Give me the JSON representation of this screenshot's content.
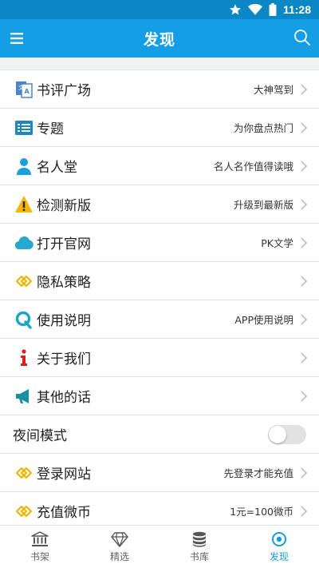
{
  "status_bar": {
    "time": "11:28"
  },
  "app_bar": {
    "title": "发现"
  },
  "rows": [
    {
      "label": "书评广场",
      "hint": "大神驾到",
      "icon": "translate-icon"
    },
    {
      "label": "专题",
      "hint": "为你盘点热门",
      "icon": "list-icon"
    },
    {
      "label": "名人堂",
      "hint": "名人名作值得读哦",
      "icon": "person-icon"
    },
    {
      "label": "检测新版",
      "hint": "升级到最新版",
      "icon": "warning-icon"
    },
    {
      "label": "打开官网",
      "hint": "PK文学",
      "icon": "cloud-icon"
    },
    {
      "label": "隐私策略",
      "hint": "",
      "icon": "link-icon"
    },
    {
      "label": "使用说明",
      "hint": "APP使用说明",
      "icon": "q-icon"
    },
    {
      "label": "关于我们",
      "hint": "",
      "icon": "info-icon"
    },
    {
      "label": "其他的话",
      "hint": "",
      "icon": "megaphone-icon"
    }
  ],
  "night_mode": {
    "label": "夜间模式",
    "enabled": false
  },
  "rows_bottom": [
    {
      "label": "登录网站",
      "hint": "先登录才能充值",
      "icon": "link-icon"
    },
    {
      "label": "充值微币",
      "hint": "1元=100微币",
      "icon": "link-icon"
    }
  ],
  "bottom_nav": [
    {
      "label": "书架",
      "icon": "bank-icon",
      "active": false
    },
    {
      "label": "精选",
      "icon": "diamond-icon",
      "active": false
    },
    {
      "label": "书库",
      "icon": "database-icon",
      "active": false
    },
    {
      "label": "发现",
      "icon": "target-icon",
      "active": true
    }
  ],
  "colors": {
    "app_bar": "#139ee6",
    "status_bar": "#0b87c5",
    "active_tab": "#1a9be0"
  }
}
